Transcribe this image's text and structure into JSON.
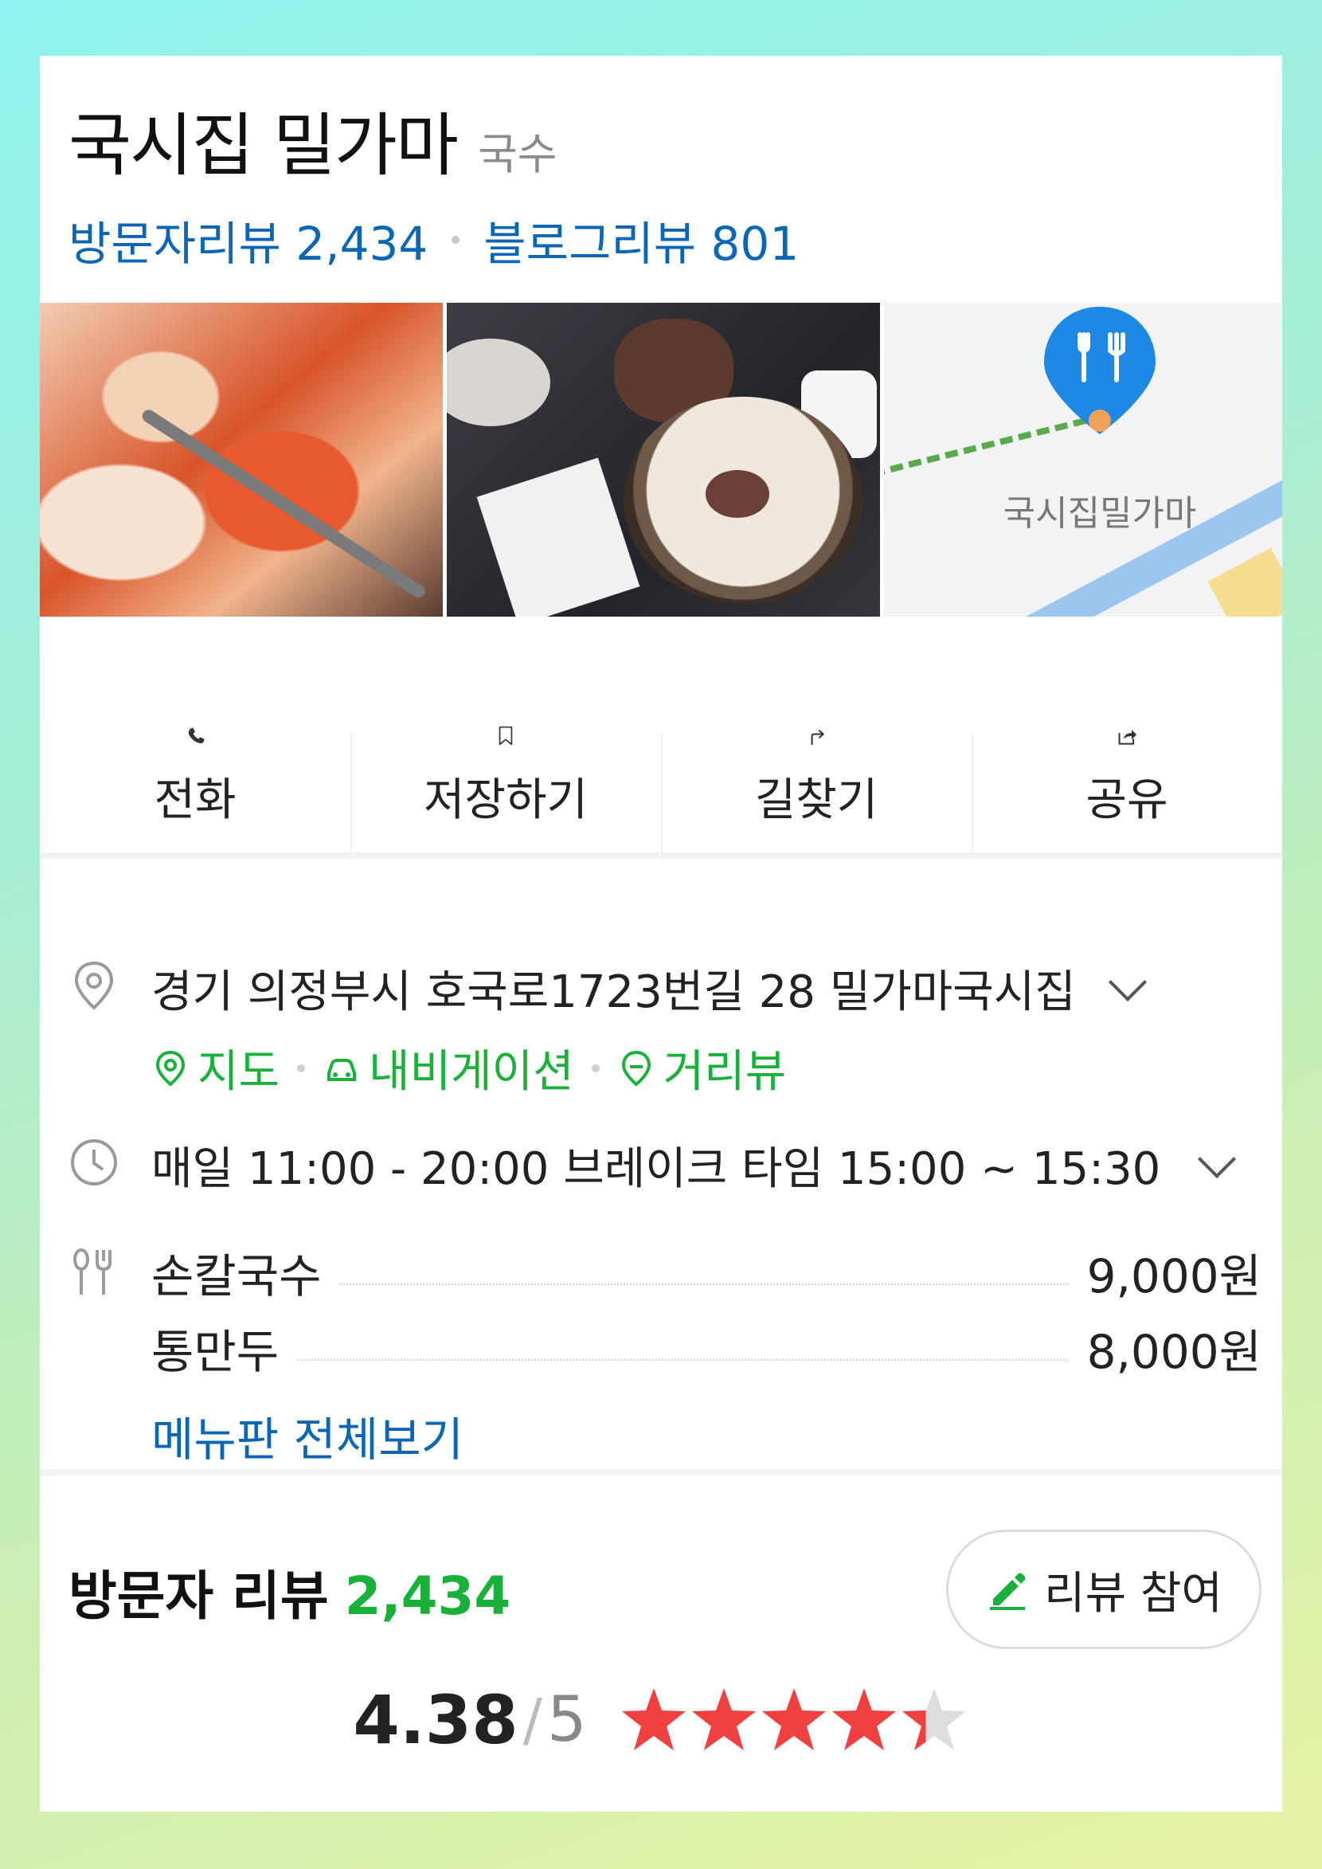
{
  "place": {
    "name": "국시집 밀가마",
    "category": "국수",
    "visitor_review_label": "방문자리뷰 2,434",
    "blog_review_label": "블로그리뷰 801"
  },
  "map": {
    "label": "국시집밀가마"
  },
  "actions": [
    {
      "label": "전화",
      "icon": "phone-icon"
    },
    {
      "label": "저장하기",
      "icon": "bookmark-icon"
    },
    {
      "label": "길찾기",
      "icon": "directions-icon"
    },
    {
      "label": "공유",
      "icon": "share-icon"
    }
  ],
  "info": {
    "address": "경기 의정부시 호국로1723번길 28 밀가마국시집",
    "links": [
      "지도",
      "내비게이션",
      "거리뷰"
    ],
    "hours": "매일 11:00 - 20:00 브레이크 타임 15:00 ~ 15:30",
    "menu": [
      {
        "name": "손칼국수",
        "price": "9,000원"
      },
      {
        "name": "통만두",
        "price": "8,000원"
      }
    ],
    "menu_all_link": "메뉴판 전체보기"
  },
  "visitor_review": {
    "title": "방문자 리뷰",
    "count": "2,434",
    "button_label": "리뷰 참여",
    "score": "4.38",
    "slash": "/",
    "max": "5",
    "rating_value": 4.38
  },
  "colors": {
    "link_blue": "#0b67b6",
    "green": "#19b13a",
    "star_red": "#f04040"
  }
}
